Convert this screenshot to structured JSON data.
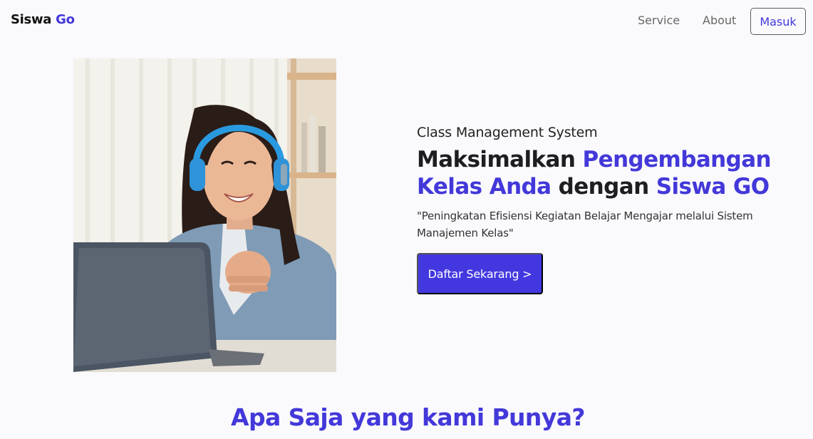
{
  "navbar": {
    "brand_part1": "Siswa",
    "brand_part2": "Go",
    "links": [
      {
        "label": "Service"
      },
      {
        "label": "About"
      }
    ],
    "login_label": "Masuk"
  },
  "hero": {
    "subtitle": "Class Management System",
    "headline": {
      "w1": "Maksimalkan",
      "w2": "Pengembangan",
      "w3": "Kelas Anda",
      "w4": "dengan",
      "w5": "Siswa GO"
    },
    "tagline": "\"Peningkatan Efisiensi Kegiatan Belajar Mengajar melalui Sistem Manajemen Kelas\"",
    "cta_label": "Daftar Sekarang >"
  },
  "section": {
    "title": "Apa Saja yang kami Punya?"
  },
  "colors": {
    "accent": "#4338d9",
    "background": "#fafafd",
    "cta": "#4338e0"
  }
}
